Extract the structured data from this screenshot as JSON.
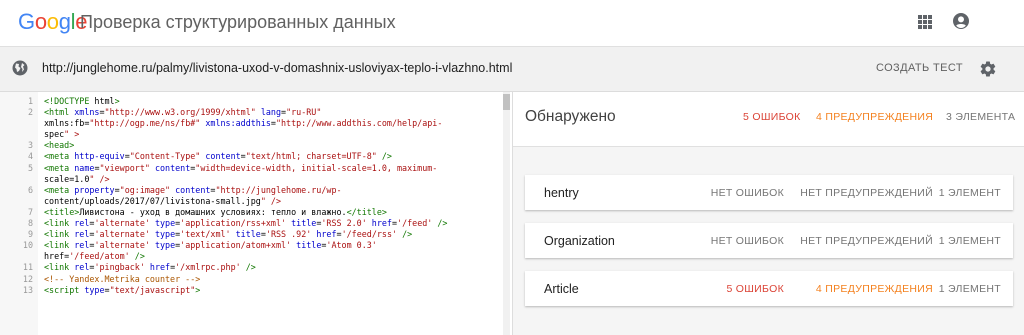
{
  "header": {
    "logo": [
      "G",
      "o",
      "o",
      "g",
      "l",
      "e"
    ],
    "logo_colors": [
      "#4285f4",
      "#ea4335",
      "#fbbc05",
      "#4285f4",
      "#34a853",
      "#ea4335"
    ],
    "title": "Проверка структурированных данных",
    "apps_icon": "apps-grid-icon",
    "account_icon": "account-circle-icon"
  },
  "urlbar": {
    "globe_icon": "globe-icon",
    "url": "http://junglehome.ru/palmy/livistona-uxod-v-domashnix-usloviyax-teplo-i-vlazhno.html",
    "run_label": "СОЗДАТЬ ТЕСТ",
    "settings_icon": "gear-icon"
  },
  "code_lines": [
    {
      "n": "1",
      "t": "<!DOCTYPE html>"
    },
    {
      "n": "2",
      "t": "<html xmlns=\"http://www.w3.org/1999/xhtml\" lang=\"ru-RU\""
    },
    {
      "n": "",
      "t": "xmlns:fb=\"http://ogp.me/ns/fb#\" xmlns:addthis=\"http://www.addthis.com/help/api-"
    },
    {
      "n": "",
      "t": "spec\" >"
    },
    {
      "n": "3",
      "t": "<head>"
    },
    {
      "n": "4",
      "t": "<meta http-equiv=\"Content-Type\" content=\"text/html; charset=UTF-8\" />"
    },
    {
      "n": "5",
      "t": "<meta name=\"viewport\" content=\"width=device-width, initial-scale=1.0, maximum-"
    },
    {
      "n": "",
      "t": "scale=1.0\" />"
    },
    {
      "n": "6",
      "t": "<meta property=\"og:image\" content=\"http://junglehome.ru/wp-"
    },
    {
      "n": "",
      "t": "content/uploads/2017/07/livistona-small.jpg\" />"
    },
    {
      "n": "7",
      "t": "<title>Ливистона - уход в домашних условиях: тепло и влажно.</title>"
    },
    {
      "n": "8",
      "t": "<link rel='alternate' type='application/rss+xml' title='RSS 2.0' href='/feed' />"
    },
    {
      "n": "9",
      "t": "<link rel='alternate' type='text/xml' title='RSS .92' href='/feed/rss' />"
    },
    {
      "n": "10",
      "t": "<link rel='alternate' type='application/atom+xml' title='Atom 0.3'"
    },
    {
      "n": "",
      "t": "href='/feed/atom' />"
    },
    {
      "n": "11",
      "t": "<link rel='pingback' href='/xmlrpc.php' />"
    },
    {
      "n": "12",
      "t": "<!-- Yandex.Metrika counter -->"
    },
    {
      "n": "13",
      "t": "<script type=\"text/javascript\">"
    }
  ],
  "results": {
    "title": "Обнаружено",
    "errors": "5 ОШИБОК",
    "warnings": "4 ПРЕДУПРЕЖДЕНИЯ",
    "items": "3 ЭЛЕМЕНТА",
    "error_color": "#db4437",
    "warning_color": "#f4811f",
    "cards": [
      {
        "name": "hentry",
        "errors": "НЕТ ОШИБОК",
        "warnings": "НЕТ ПРЕДУПРЕЖДЕНИЙ",
        "items": "1 ЭЛЕМЕНТ"
      },
      {
        "name": "Organization",
        "errors": "НЕТ ОШИБОК",
        "warnings": "НЕТ ПРЕДУПРЕЖДЕНИЙ",
        "items": "1 ЭЛЕМЕНТ"
      },
      {
        "name": "Article",
        "errors": "5 ОШИБОК",
        "warnings": "4 ПРЕДУПРЕЖДЕНИЯ",
        "items": "1 ЭЛЕМЕНТ"
      }
    ]
  }
}
